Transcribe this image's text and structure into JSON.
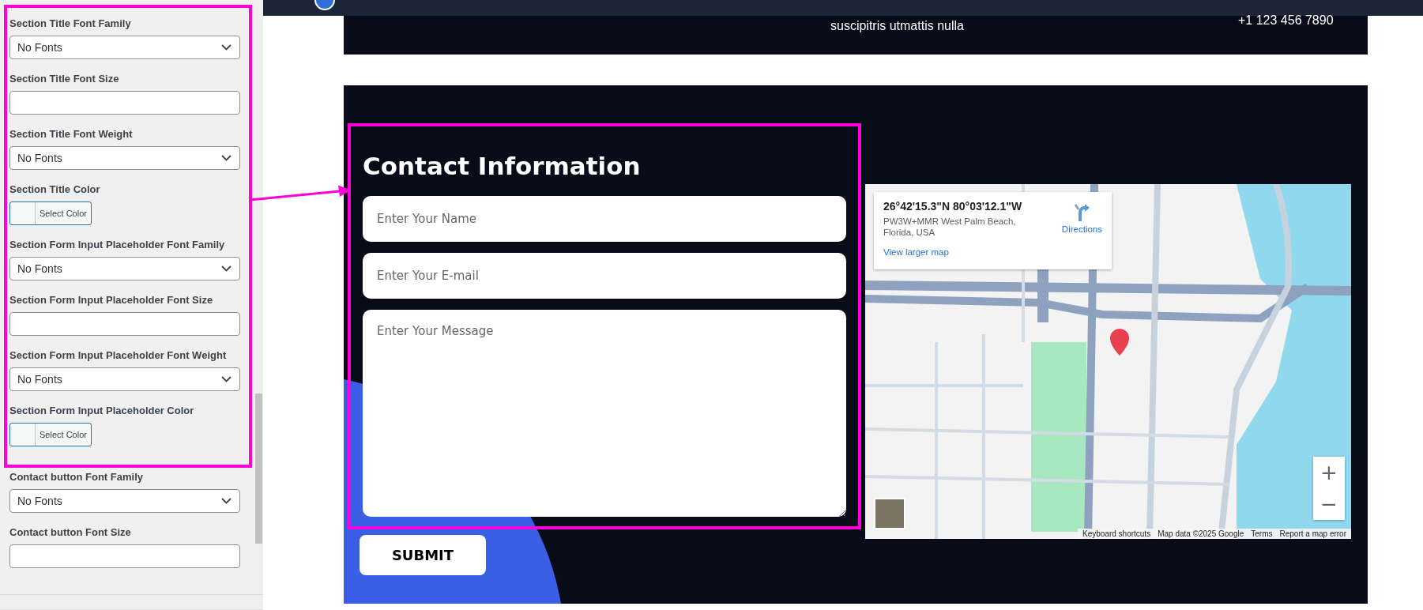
{
  "sidebar": {
    "highlighted_fields": [
      {
        "label": "Section Title Font Family",
        "kind": "select",
        "value": "No Fonts"
      },
      {
        "label": "Section Title Font Size",
        "kind": "text"
      },
      {
        "label": "Section Title Font Weight",
        "kind": "select",
        "value": "No Fonts"
      },
      {
        "label": "Section Title Color",
        "kind": "color",
        "button": "Select Color"
      },
      {
        "label": "Section Form Input Placeholder Font Family",
        "kind": "select",
        "value": "No Fonts"
      },
      {
        "label": "Section Form Input Placeholder Font Size",
        "kind": "text"
      },
      {
        "label": "Section Form Input Placeholder Font Weight",
        "kind": "select",
        "value": "No Fonts"
      },
      {
        "label": "Section Form Input Placeholder Color",
        "kind": "color",
        "button": "Select Color"
      }
    ],
    "fields": [
      {
        "label": "Contact button Font Family",
        "kind": "select",
        "value": "No Fonts"
      },
      {
        "label": "Contact button Font Size",
        "kind": "text"
      }
    ]
  },
  "top_banner": {
    "text": "suscipitris utmattis nulla",
    "phone": "+1 123 456 7890"
  },
  "contact": {
    "title": "Contact Information",
    "highlighted": true,
    "fields": [
      {
        "kind": "input",
        "placeholder": "Enter Your Name"
      },
      {
        "kind": "input",
        "placeholder": "Enter Your E-mail"
      },
      {
        "kind": "textarea",
        "placeholder": "Enter Your Message"
      }
    ],
    "submit": "SUBMIT"
  },
  "map": {
    "coordinates": "26°42'15.3\"N 80°03'12.1\"W",
    "address": "PW3W+MMR West Palm Beach, Florida, USA",
    "directions": "Directions",
    "larger_map_link": "View larger map",
    "zoom_in": "+",
    "zoom_out": "−",
    "footer_links": [
      "Keyboard shortcuts",
      "Map data ©2025 Google",
      "Terms",
      "Report a map error"
    ]
  }
}
